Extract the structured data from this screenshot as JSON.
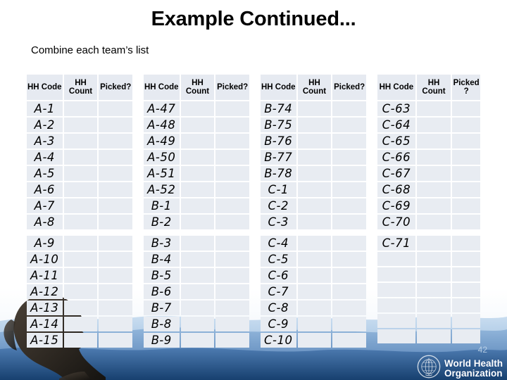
{
  "slide": {
    "title": "Example Continued...",
    "subtitle": "Combine each team’s list",
    "page_number": "42"
  },
  "footer": {
    "org_line1": "World Health",
    "org_line2": "Organization",
    "emblem_name": "who-emblem-icon"
  },
  "table_headers": {
    "code": "HH Code",
    "count_line1": "HH",
    "count_line2": "Count",
    "picked": "Picked?",
    "picked_line1": "Picked",
    "picked_line2": "?"
  },
  "tables": [
    {
      "id": "team-1",
      "codes": [
        "A-1",
        "A-2",
        "A-3",
        "A-4",
        "A-5",
        "A-6",
        "A-7",
        "A-8",
        "A-9",
        "A-10",
        "A-11",
        "A-12",
        "A-13",
        "A-14",
        "A-15"
      ],
      "counts": [
        "",
        "",
        "",
        "",
        "",
        "",
        "",
        "",
        "",
        "",
        "",
        "",
        "",
        "",
        ""
      ],
      "picked": [
        "",
        "",
        "",
        "",
        "",
        "",
        "",
        "",
        "",
        "",
        "",
        "",
        "",
        "",
        ""
      ]
    },
    {
      "id": "team-2",
      "codes": [
        "A-47",
        "A-48",
        "A-49",
        "A-50",
        "A-51",
        "A-52",
        "B-1",
        "B-2",
        "B-3",
        "B-4",
        "B-5",
        "B-6",
        "B-7",
        "B-8",
        "B-9"
      ],
      "counts": [
        "",
        "",
        "",
        "",
        "",
        "",
        "",
        "",
        "",
        "",
        "",
        "",
        "",
        "",
        ""
      ],
      "picked": [
        "",
        "",
        "",
        "",
        "",
        "",
        "",
        "",
        "",
        "",
        "",
        "",
        "",
        "",
        ""
      ]
    },
    {
      "id": "team-3",
      "codes": [
        "B-74",
        "B-75",
        "B-76",
        "B-77",
        "B-78",
        "C-1",
        "C-2",
        "C-3",
        "C-4",
        "C-5",
        "C-6",
        "C-7",
        "C-8",
        "C-9",
        "C-10"
      ],
      "counts": [
        "",
        "",
        "",
        "",
        "",
        "",
        "",
        "",
        "",
        "",
        "",
        "",
        "",
        "",
        ""
      ],
      "picked": [
        "",
        "",
        "",
        "",
        "",
        "",
        "",
        "",
        "",
        "",
        "",
        "",
        "",
        "",
        ""
      ]
    },
    {
      "id": "team-4",
      "codes": [
        "C-63",
        "C-64",
        "C-65",
        "C-66",
        "C-67",
        "C-68",
        "C-69",
        "C-70",
        "C-71",
        "",
        "",
        "",
        "",
        "",
        ""
      ],
      "counts": [
        "",
        "",
        "",
        "",
        "",
        "",
        "",
        "",
        "",
        "",
        "",
        "",
        "",
        "",
        ""
      ],
      "picked": [
        "",
        "",
        "",
        "",
        "",
        "",
        "",
        "",
        "",
        "",
        "",
        "",
        "",
        "",
        ""
      ]
    }
  ],
  "layout": {
    "gap_after_row_index": 8
  },
  "colors": {
    "cell_fill": "#e8ecf2",
    "header_fill": "#e6eaf1",
    "background": "#ffffff",
    "water_blue": "#2a5e9e",
    "text": "#000000"
  }
}
